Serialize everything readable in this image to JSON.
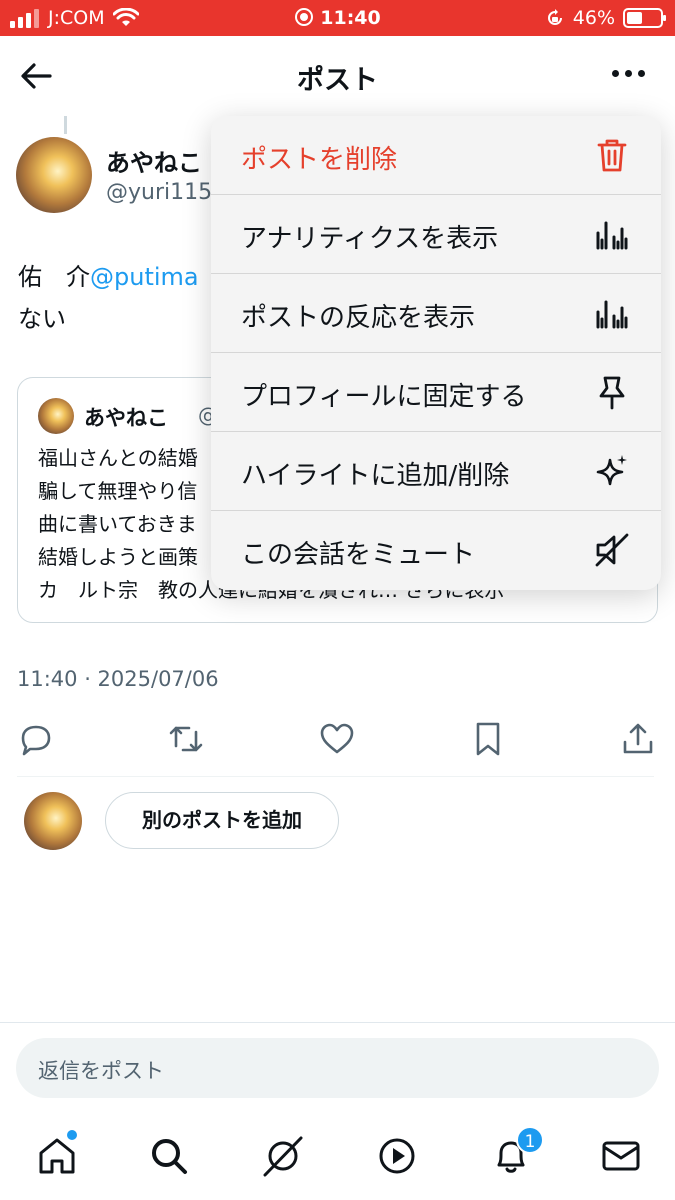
{
  "status_bar": {
    "carrier": "J:COM",
    "time": "11:40",
    "battery": "46%",
    "battery_level": 0.46
  },
  "header": {
    "title": "ポスト"
  },
  "post": {
    "name": "あやねこ",
    "handle": "@yuri115",
    "text_line1_prefix": "佑　介",
    "mention": "@putima",
    "text_line2": "ない",
    "timestamp": "11:40 · 2025/07/06"
  },
  "quote": {
    "name": "あやねこ",
    "handle": "@y",
    "lines": [
      "福山さんとの結婚",
      "騙して無理やり信",
      "曲に書いておきま",
      "結婚しようと画策",
      "カ　ルト宗　教の人達に結婚を潰され… さらに表示"
    ]
  },
  "menu": {
    "items": [
      {
        "label": "ポストを削除",
        "icon": "trash-icon",
        "danger": true
      },
      {
        "label": "アナリティクスを表示",
        "icon": "analytics-icon",
        "danger": false
      },
      {
        "label": "ポストの反応を表示",
        "icon": "analytics-icon",
        "danger": false
      },
      {
        "label": "プロフィールに固定する",
        "icon": "pin-icon",
        "danger": false
      },
      {
        "label": "ハイライトに追加/削除",
        "icon": "sparkle-icon",
        "danger": false
      },
      {
        "label": "この会話をミュート",
        "icon": "mute-icon",
        "danger": false
      }
    ]
  },
  "compose": {
    "add_post_label": "別のポストを追加",
    "reply_placeholder": "返信をポスト"
  },
  "tabbar": {
    "notifications_badge": "1"
  },
  "colors": {
    "status_bar": "#e8352d",
    "accent": "#1d9bf0",
    "danger": "#e5402c",
    "secondary_text": "#536471"
  }
}
